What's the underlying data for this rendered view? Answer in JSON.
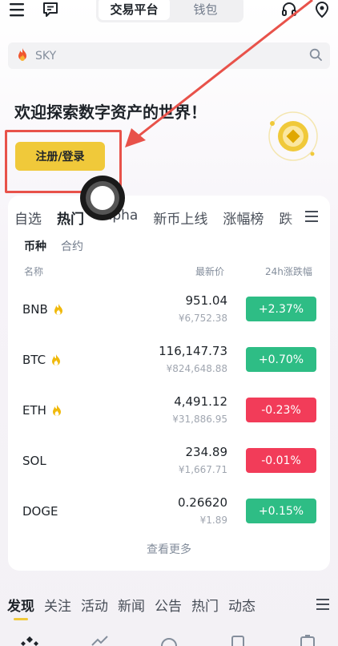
{
  "topbar": {
    "menu_icon": "hamburger-menu-icon",
    "chat_icon": "message-icon",
    "seg_active": "交易平台",
    "seg_inactive": "钱包",
    "support_icon": "headset-icon",
    "profile_icon": "avatar-icon"
  },
  "search": {
    "text": "SKY"
  },
  "hero": {
    "welcome": "欢迎探索数字资产的世界！",
    "cta": "注册/登录"
  },
  "market": {
    "tabs": [
      "自选",
      "热门",
      "Alpha",
      "新币上线",
      "涨幅榜",
      "跌"
    ],
    "subtabs": [
      "币种",
      "合约"
    ],
    "col_name": "名称",
    "col_price": "最新价",
    "col_change": "24h涨跌幅",
    "rows": [
      {
        "sym": "BNB",
        "price": "951.04",
        "fiat": "¥6,752.38",
        "change": "+2.37%",
        "up": true
      },
      {
        "sym": "BTC",
        "price": "116,147.73",
        "fiat": "¥824,648.88",
        "change": "+0.70%",
        "up": true
      },
      {
        "sym": "ETH",
        "price": "4,491.12",
        "fiat": "¥31,886.95",
        "change": "-0.23%",
        "up": false
      },
      {
        "sym": "SOL",
        "price": "234.89",
        "fiat": "¥1,667.71",
        "change": "-0.01%",
        "up": false
      },
      {
        "sym": "DOGE",
        "price": "0.26620",
        "fiat": "¥1.89",
        "change": "+0.15%",
        "up": true
      }
    ],
    "more": "查看更多"
  },
  "feed": {
    "tabs": [
      "发现",
      "关注",
      "活动",
      "新闻",
      "公告",
      "热门",
      "动态"
    ]
  },
  "colors": {
    "accent": "#f0c93a",
    "up": "#2ebd85",
    "down": "#f23c59",
    "annotation": "#e8524a"
  }
}
